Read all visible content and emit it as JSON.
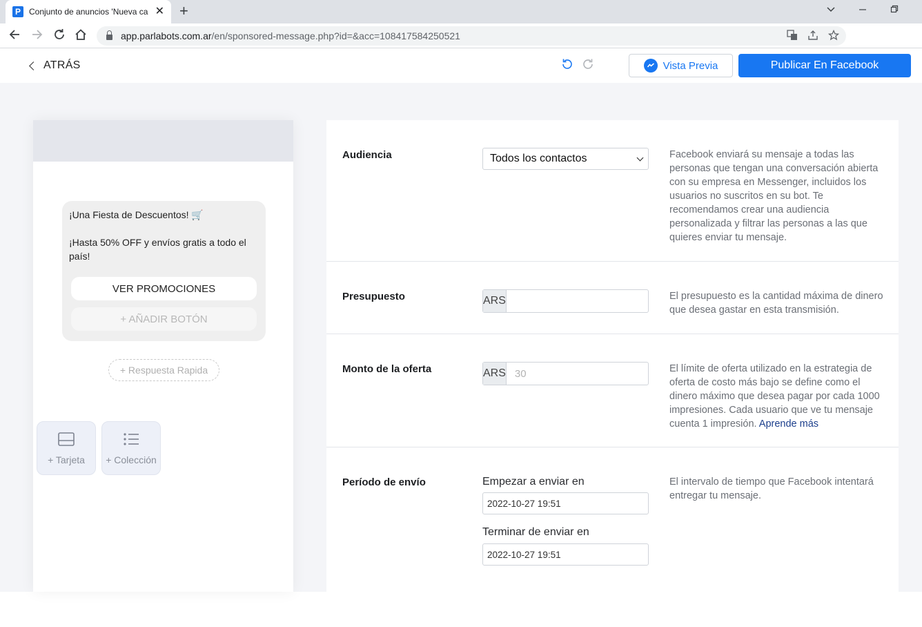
{
  "browser": {
    "tab_title": "Conjunto de anuncios 'Nueva ca",
    "favicon_letter": "P",
    "tab_close": "✕",
    "new_tab": "+",
    "url_host": "app.parlabots.com.ar",
    "url_path": "/en/sponsored-message.php?id=&acc=108417584250521"
  },
  "header": {
    "back_label": "ATRÁS",
    "preview_label": "Vista Previa",
    "publish_label": "Publicar En Facebook"
  },
  "preview": {
    "line1": "¡Una Fiesta de Descuentos! 🛒",
    "line2": "¡Hasta 50% OFF y envíos gratis a todo el país!",
    "button_label": "VER PROMOCIONES",
    "add_button_label": "+ AÑADIR BOTÓN",
    "quick_reply_label": "+ Respuesta Rapida",
    "card_label": "+ Tarjeta",
    "collection_label": "+ Colección"
  },
  "form": {
    "audience": {
      "label": "Audiencia",
      "selected": "Todos los contactos",
      "help": "Facebook enviará su mensaje a todas las personas que tengan una conversación abierta con su empresa en Messenger, incluidos los usuarios no suscritos en su bot. Te recomendamos crear una audiencia personalizada y filtrar las personas a las que quieres enviar tu mensaje."
    },
    "budget": {
      "label": "Presupuesto",
      "currency": "ARS",
      "value": "",
      "help": "El presupuesto es la cantidad máxima de dinero que desea gastar en esta transmisión."
    },
    "bid": {
      "label": "Monto de la oferta",
      "currency": "ARS",
      "placeholder": "30",
      "help": "El límite de oferta utilizado en la estrategia de oferta de costo más bajo se define como el dinero máximo que desea pagar por cada 1000 impresiones. Cada usuario que ve tu mensaje cuenta 1 impresión.",
      "help_link": "Aprende más"
    },
    "period": {
      "label": "Período de envío",
      "start_label": "Empezar a enviar en",
      "start_value": "2022-10-27 19:51",
      "end_label": "Terminar de enviar en",
      "end_value": "2022-10-27 19:51",
      "help": "El intervalo de tiempo que Facebook intentará entregar tu mensaje."
    }
  },
  "colors": {
    "accent": "#1877f2",
    "canvas_bg": "#f4f5f8"
  }
}
